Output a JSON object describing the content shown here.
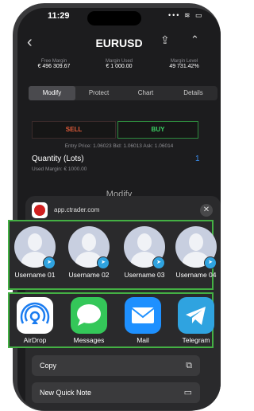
{
  "status": {
    "time": "11:29",
    "icons": "••• ≋ ▭"
  },
  "nav": {
    "title": "EURUSD",
    "back_icon": "‹",
    "share_icon": "⇪",
    "collapse_icon": "⌃"
  },
  "stats": [
    {
      "label": "Free Margin",
      "value": "€ 496 309.67"
    },
    {
      "label": "Margin Used",
      "value": "€ 1 000.00"
    },
    {
      "label": "Margin Level",
      "value": "49 731.42%"
    }
  ],
  "tabs": [
    "Modify",
    "Protect",
    "Chart",
    "Details"
  ],
  "order": {
    "sell_label": "SELL",
    "buy_label": "BUY",
    "prices": "Entry Price: 1.06023  Bid: 1.06013  Ask: 1.06014",
    "quantity_label": "Quantity (Lots)",
    "quantity_value": "1",
    "used_margin": "Used Margin: € 1000.00",
    "modify_label": "Modify"
  },
  "share": {
    "url": "app.ctrader.com",
    "close_icon": "✕",
    "contacts": [
      {
        "name": "Username 01"
      },
      {
        "name": "Username 02"
      },
      {
        "name": "Username 03"
      },
      {
        "name": "Username 04"
      }
    ],
    "apps": [
      {
        "name": "AirDrop",
        "icon": "airdrop-icon"
      },
      {
        "name": "Messages",
        "icon": "messages-icon"
      },
      {
        "name": "Mail",
        "icon": "mail-icon"
      },
      {
        "name": "Telegram",
        "icon": "telegram-icon"
      }
    ],
    "actions": [
      {
        "label": "Copy",
        "icon": "copy-icon"
      },
      {
        "label": "New Quick Note",
        "icon": "quick-note-icon"
      }
    ]
  },
  "colors": {
    "accent_green": "#44b044",
    "sell": "#e45c3a",
    "buy": "#3cd164",
    "link": "#3a8ef0"
  }
}
